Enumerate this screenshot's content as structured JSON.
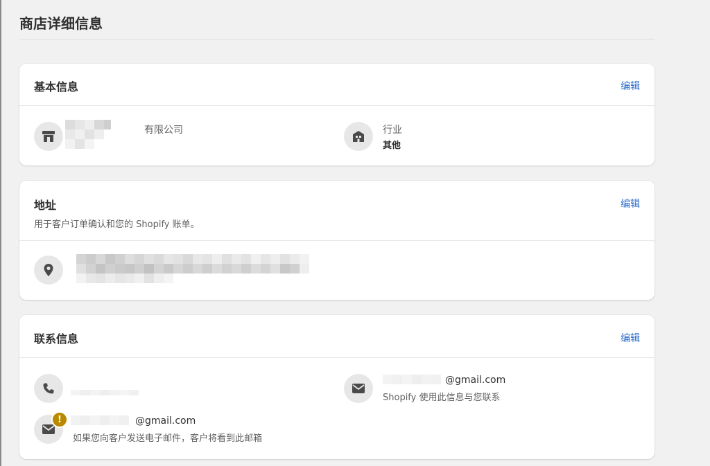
{
  "page": {
    "title": "商店详细信息"
  },
  "basic": {
    "title": "基本信息",
    "edit_label": "编辑",
    "company_suffix": "有限公司",
    "industry_label": "行业",
    "industry_value": "其他"
  },
  "address": {
    "title": "地址",
    "subtitle": "用于客户订单确认和您的 Shopify 账单。",
    "edit_label": "编辑"
  },
  "contact": {
    "title": "联系信息",
    "edit_label": "编辑",
    "store_email_suffix": "@gmail.com",
    "store_email_note": "Shopify 使用此信息与您联系",
    "sender_email_suffix": "@gmail.com",
    "sender_email_note": "如果您向客户发送电子邮件，客户将看到此邮箱",
    "warning_badge": "!"
  },
  "icons": {
    "store": "store-icon",
    "industry": "building-icon",
    "location": "location-pin-icon",
    "phone": "phone-icon",
    "email": "email-icon",
    "warning": "warning-badge-icon"
  },
  "colors": {
    "link": "#2c6ecb",
    "icon_bg": "#e7e7e7",
    "warning": "#b98900",
    "page_bg": "#f1f1f1"
  }
}
